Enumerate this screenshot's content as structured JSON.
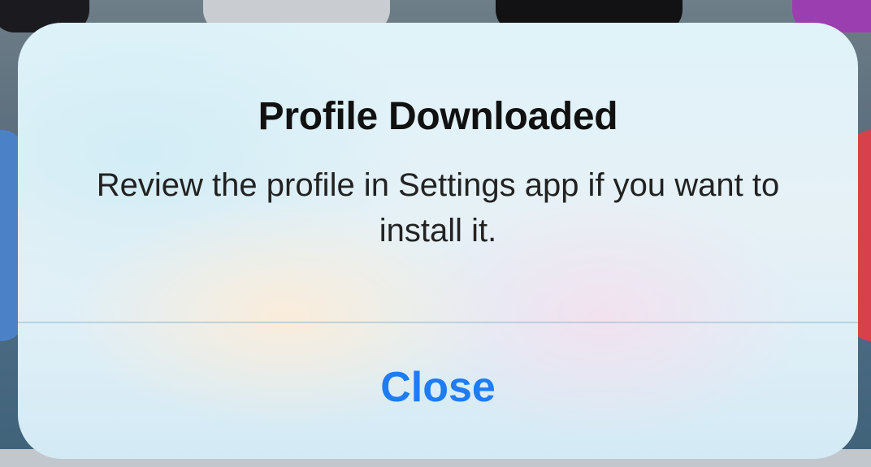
{
  "alert": {
    "title": "Profile Downloaded",
    "message": "Review the profile in Settings app if you want to install it.",
    "close_label": "Close"
  },
  "colors": {
    "button_text": "#1f7cf2",
    "title_text": "#111111",
    "message_text": "#222222"
  }
}
